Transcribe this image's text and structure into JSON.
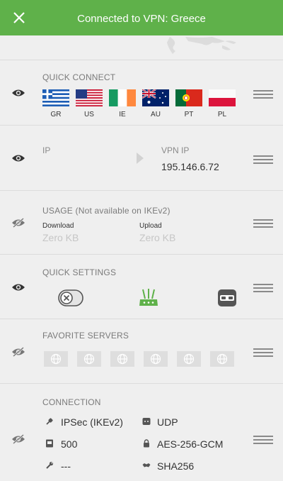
{
  "header": {
    "title": "Connected to VPN: Greece",
    "close_icon": "close-icon",
    "bg_color": "#5fb14a"
  },
  "quick_connect": {
    "title": "QUICK CONNECT",
    "flags": [
      {
        "code": "GR"
      },
      {
        "code": "US"
      },
      {
        "code": "IE"
      },
      {
        "code": "AU"
      },
      {
        "code": "PT"
      },
      {
        "code": "PL"
      }
    ]
  },
  "ip": {
    "label": "IP",
    "vpn_label": "VPN IP",
    "vpn_value": "195.146.6.72"
  },
  "usage": {
    "title": "USAGE (Not available on IKEv2)",
    "download_label": "Download",
    "download_value": "Zero KB",
    "upload_label": "Upload",
    "upload_value": "Zero KB"
  },
  "quick_settings": {
    "title": "QUICK SETTINGS"
  },
  "favorite_servers": {
    "title": "FAVORITE SERVERS",
    "count": 6
  },
  "connection": {
    "title": "CONNECTION",
    "protocol": "IPSec (IKEv2)",
    "transport": "UDP",
    "mtu": "500",
    "cipher": "AES-256-GCM",
    "extra": "---",
    "hash": "SHA256"
  }
}
